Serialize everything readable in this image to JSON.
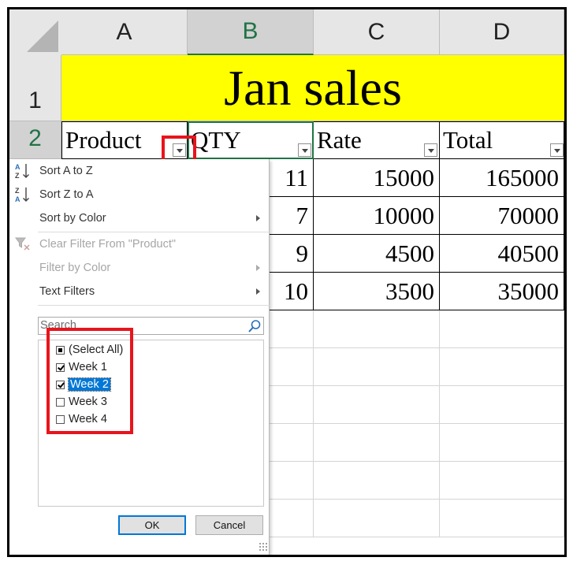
{
  "columns": [
    "A",
    "B",
    "C",
    "D"
  ],
  "rows": [
    "1",
    "2"
  ],
  "title": "Jan sales",
  "headers": [
    "Product",
    "QTY",
    "Rate",
    "Total"
  ],
  "data_rows": [
    {
      "qty": "11",
      "rate": "15000",
      "total": "165000"
    },
    {
      "qty": "7",
      "rate": "10000",
      "total": "70000"
    },
    {
      "qty": "9",
      "rate": "4500",
      "total": "40500"
    },
    {
      "qty": "10",
      "rate": "3500",
      "total": "35000"
    }
  ],
  "menu": {
    "sort_az": "Sort A to Z",
    "sort_za": "Sort Z to A",
    "sort_color": "Sort by Color",
    "clear_filter": "Clear Filter From \"Product\"",
    "filter_color": "Filter by Color",
    "text_filters": "Text Filters",
    "search_placeholder": "Search",
    "items": [
      {
        "label": "(Select All)",
        "state": "partial"
      },
      {
        "label": "Week 1",
        "state": "checked"
      },
      {
        "label": "Week 2",
        "state": "checked"
      },
      {
        "label": "Week 3",
        "state": "unchecked"
      },
      {
        "label": "Week 4",
        "state": "unchecked"
      }
    ],
    "ok": "OK",
    "cancel": "Cancel"
  },
  "colors": {
    "title_fill": "#ffff00",
    "highlight": "#e8141c",
    "excel_green": "#217346",
    "selection": "#0078d7"
  },
  "icons": [
    "sort-az-icon",
    "sort-za-icon",
    "clear-filter-icon",
    "search-icon",
    "dropdown-arrow-icon",
    "submenu-arrow-icon"
  ]
}
